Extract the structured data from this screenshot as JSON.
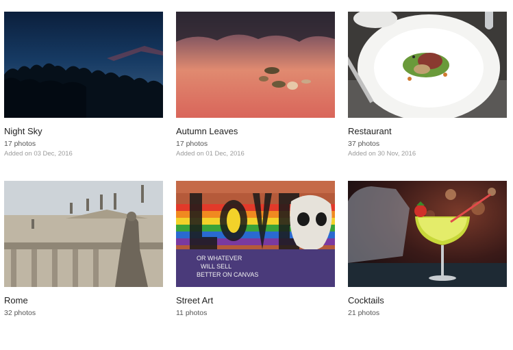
{
  "albums": [
    {
      "title": "Night Sky",
      "count": "17 photos",
      "date": "Added on 03 Dec, 2016",
      "image": "night-sky-photo"
    },
    {
      "title": "Autumn Leaves",
      "count": "17 photos",
      "date": "Added on 01 Dec, 2016",
      "image": "autumn-leaves-photo"
    },
    {
      "title": "Restaurant",
      "count": "37 photos",
      "date": "Added on 30 Nov, 2016",
      "image": "restaurant-photo"
    },
    {
      "title": "Rome",
      "count": "32 photos",
      "date": "",
      "image": "rome-photo"
    },
    {
      "title": "Street Art",
      "count": "11 photos",
      "date": "",
      "image": "street-art-photo"
    },
    {
      "title": "Cocktails",
      "count": "21 photos",
      "date": "",
      "image": "cocktails-photo"
    }
  ],
  "street_art_text": [
    "OR WHATEVER",
    "WILL SELL",
    "BETTER ON CANVAS"
  ]
}
